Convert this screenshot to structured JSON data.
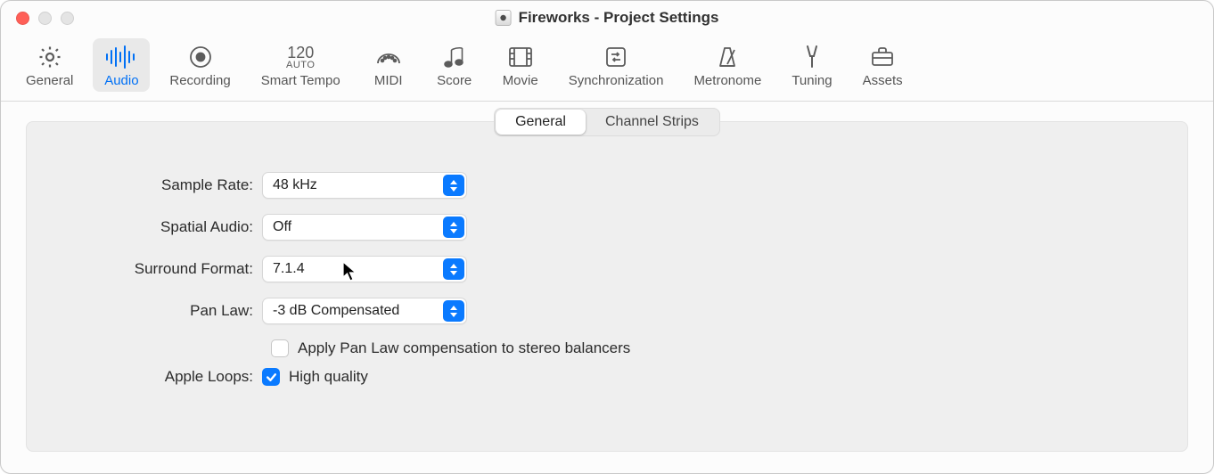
{
  "window": {
    "title": "Fireworks - Project Settings"
  },
  "toolbar": {
    "items": [
      {
        "name": "general",
        "label": "General"
      },
      {
        "name": "audio",
        "label": "Audio"
      },
      {
        "name": "recording",
        "label": "Recording"
      },
      {
        "name": "smart-tempo",
        "label": "Smart Tempo",
        "num": "120",
        "sub": "AUTO"
      },
      {
        "name": "midi",
        "label": "MIDI"
      },
      {
        "name": "score",
        "label": "Score"
      },
      {
        "name": "movie",
        "label": "Movie"
      },
      {
        "name": "synchronization",
        "label": "Synchronization"
      },
      {
        "name": "metronome",
        "label": "Metronome"
      },
      {
        "name": "tuning",
        "label": "Tuning"
      },
      {
        "name": "assets",
        "label": "Assets"
      }
    ],
    "active": "audio"
  },
  "tabs": {
    "general": "General",
    "channel_strips": "Channel Strips",
    "active": "general"
  },
  "form": {
    "sample_rate": {
      "label": "Sample Rate:",
      "value": "48 kHz"
    },
    "spatial_audio": {
      "label": "Spatial Audio:",
      "value": "Off"
    },
    "surround_format": {
      "label": "Surround Format:",
      "value": "7.1.4"
    },
    "pan_law": {
      "label": "Pan Law:",
      "value": "-3 dB Compensated"
    },
    "pan_law_stereo": {
      "label": "Apply Pan Law compensation to stereo balancers",
      "checked": false
    },
    "apple_loops": {
      "label": "Apple Loops:",
      "option_label": "High quality",
      "checked": true
    }
  }
}
